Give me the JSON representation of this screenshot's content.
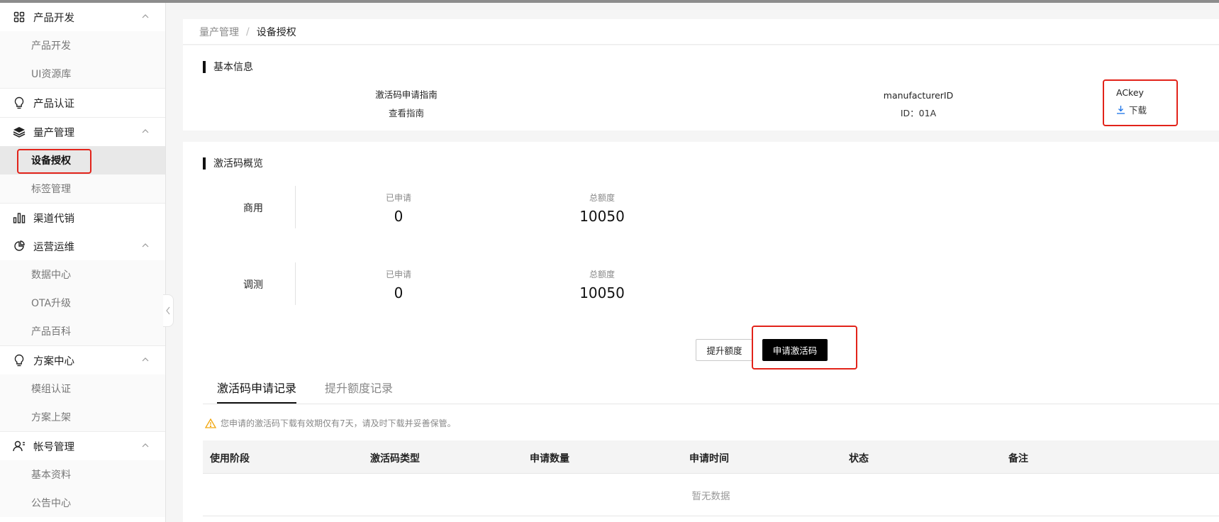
{
  "sidebar": {
    "groups": [
      {
        "label": "产品开发",
        "icon": "grid-icon",
        "items": [
          "产品开发",
          "UI资源库"
        ]
      },
      {
        "label": "产品认证",
        "icon": "lightbulb-icon",
        "items": []
      },
      {
        "label": "量产管理",
        "icon": "layers-icon",
        "items": [
          "设备授权",
          "标签管理"
        ]
      },
      {
        "label": "渠道代销",
        "icon": "bar-chart-icon",
        "items": []
      },
      {
        "label": "运营运维",
        "icon": "pie-chart-icon",
        "items": [
          "数据中心",
          "OTA升级",
          "产品百科"
        ]
      },
      {
        "label": "方案中心",
        "icon": "lightbulb-icon",
        "items": [
          "模组认证",
          "方案上架"
        ]
      },
      {
        "label": "帐号管理",
        "icon": "user-icon",
        "items": [
          "基本资料",
          "公告中心"
        ]
      }
    ],
    "active_item": "设备授权"
  },
  "breadcrumb": {
    "parent": "量产管理",
    "separator": "/",
    "current": "设备授权"
  },
  "basic_info": {
    "title": "基本信息",
    "guide_label": "激活码申请指南",
    "guide_link": "查看指南",
    "manufacturer_label": "manufacturerID",
    "manufacturer_id": "ID：01A",
    "ackey_label": "ACkey",
    "ackey_download": "下载"
  },
  "overview": {
    "title": "激活码概览",
    "rows": [
      {
        "label": "商用",
        "applied_label": "已申请",
        "applied": "0",
        "total_label": "总额度",
        "total": "10050"
      },
      {
        "label": "调测",
        "applied_label": "已申请",
        "applied": "0",
        "total_label": "总额度",
        "total": "10050"
      }
    ],
    "raise_quota_button": "提升额度",
    "apply_button": "申请激活码"
  },
  "tabs": {
    "active": "激活码申请记录",
    "inactive": "提升额度记录"
  },
  "notice": "您申请的激活码下载有效期仅有7天，请及时下载并妥善保管。",
  "table": {
    "columns": [
      "使用阶段",
      "激活码类型",
      "申请数量",
      "申请时间",
      "状态",
      "备注"
    ],
    "empty_text": "暂无数据"
  },
  "colors": {
    "accent": "#000000",
    "link": "#1a73e8",
    "highlight": "#e2231a"
  }
}
